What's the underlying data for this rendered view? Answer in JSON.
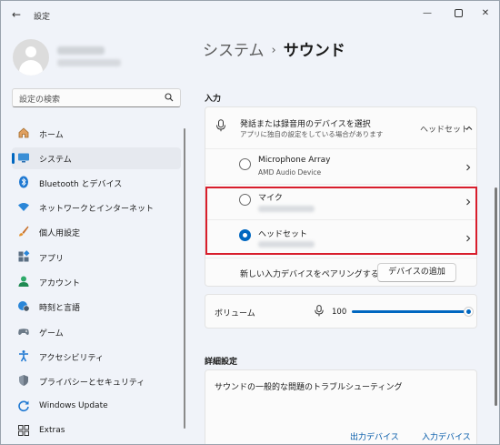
{
  "window": {
    "title": "設定"
  },
  "sidebar": {
    "search_placeholder": "設定の検索",
    "items": [
      {
        "label": "ホーム"
      },
      {
        "label": "システム"
      },
      {
        "label": "Bluetooth とデバイス"
      },
      {
        "label": "ネットワークとインターネット"
      },
      {
        "label": "個人用設定"
      },
      {
        "label": "アプリ"
      },
      {
        "label": "アカウント"
      },
      {
        "label": "時刻と言語"
      },
      {
        "label": "ゲーム"
      },
      {
        "label": "アクセシビリティ"
      },
      {
        "label": "プライバシーとセキュリティ"
      },
      {
        "label": "Windows Update"
      },
      {
        "label": "Extras"
      }
    ]
  },
  "breadcrumb": {
    "parent": "システム",
    "separator": "›",
    "current": "サウンド"
  },
  "input_section": {
    "heading": "入力",
    "select_title": "発話または録音用のデバイスを選択",
    "select_subtitle": "アプリに独自の設定をしている場合があります",
    "selected_device": "ヘッドセット",
    "devices": [
      {
        "name": "Microphone Array",
        "detail": "AMD Audio Device",
        "selected": false
      },
      {
        "name": "マイク",
        "selected": false
      },
      {
        "name": "ヘッドセット",
        "selected": true
      }
    ],
    "pair_text": "新しい入力デバイスをペアリングする",
    "add_device_button": "デバイスの追加",
    "volume_label": "ボリューム",
    "volume_value": "100",
    "volume_level": 1.0
  },
  "advanced_section": {
    "heading": "詳細設定",
    "troubleshoot_title": "サウンドの一般的な問題のトラブルシューティング",
    "link_output": "出力デバイス",
    "link_input": "入力デバイス"
  },
  "colors": {
    "accent": "#0067c0",
    "highlight_box": "#d81e2c"
  }
}
